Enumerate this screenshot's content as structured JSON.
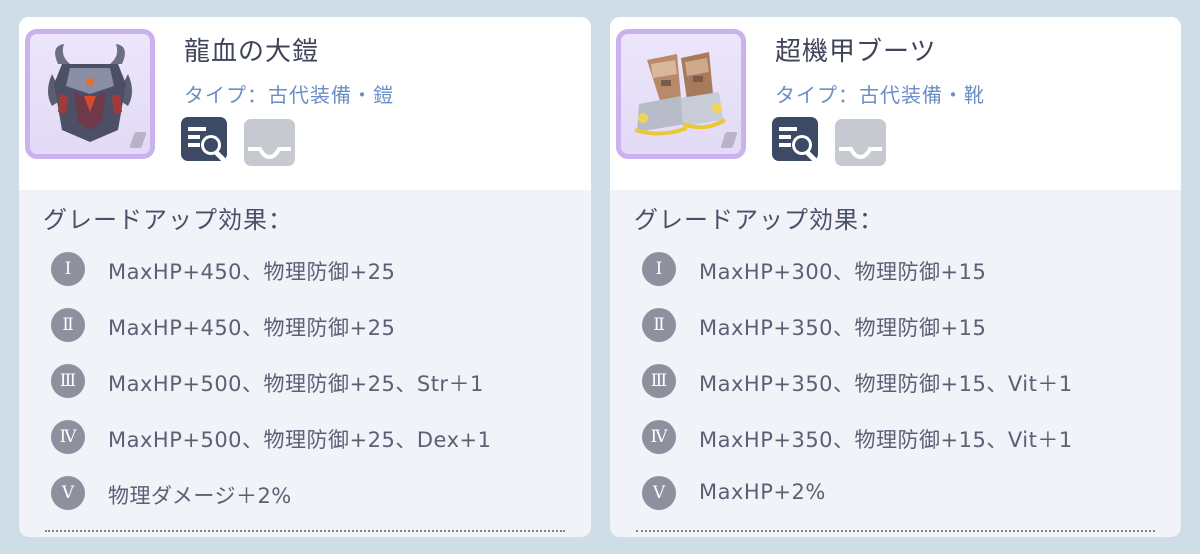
{
  "items": [
    {
      "name": "龍血の大鎧",
      "type": "タイプ：古代装備・鎧",
      "section_title": "グレードアップ効果：",
      "effects": [
        {
          "numeral": "Ⅰ",
          "text": "MaxHP+450、物理防御+25"
        },
        {
          "numeral": "Ⅱ",
          "text": "MaxHP+450、物理防御+25"
        },
        {
          "numeral": "Ⅲ",
          "text": "MaxHP+500、物理防御+25、Str＋1"
        },
        {
          "numeral": "Ⅳ",
          "text": "MaxHP+500、物理防御+25、Dex+1"
        },
        {
          "numeral": "Ⅴ",
          "text": "物理ダメージ＋2%"
        }
      ]
    },
    {
      "name": "超機甲ブーツ",
      "type": "タイプ：古代装備・靴",
      "section_title": "グレードアップ効果：",
      "effects": [
        {
          "numeral": "Ⅰ",
          "text": "MaxHP+300、物理防御+15"
        },
        {
          "numeral": "Ⅱ",
          "text": "MaxHP+350、物理防御+15"
        },
        {
          "numeral": "Ⅲ",
          "text": "MaxHP+350、物理防御+15、Vit＋1"
        },
        {
          "numeral": "Ⅳ",
          "text": "MaxHP+350、物理防御+15、Vit＋1"
        },
        {
          "numeral": "Ⅴ",
          "text": "MaxHP+2%"
        }
      ]
    }
  ],
  "icons": {
    "item_left": "dragon-armor-icon",
    "item_right": "mech-boots-icon",
    "inspect": "item-inspect-icon",
    "tray": "inbox-tray-icon"
  },
  "colors": {
    "background": "#cfdde6",
    "frame_border": "#c9b2ee",
    "subtitle": "#6b8ec6",
    "badge": "#8e919d",
    "inspect_icon": "#3c4a66",
    "tray_icon_disabled": "#c6c9cf"
  }
}
